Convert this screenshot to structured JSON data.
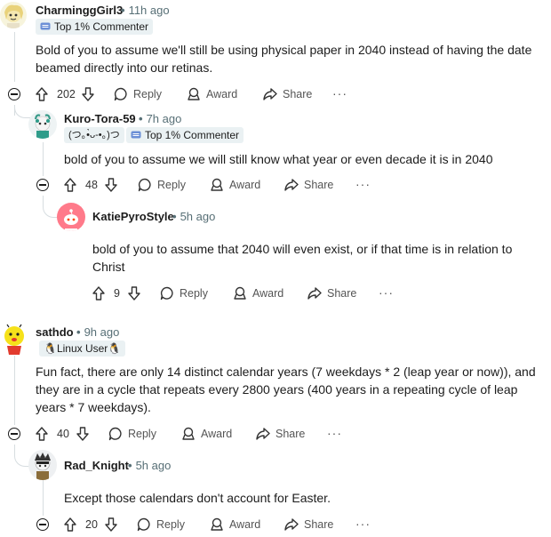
{
  "comments": [
    {
      "username": "CharminggGirl3",
      "time": "11h ago",
      "flair": "Top 1% Commenter",
      "body": "Bold of you to assume we'll still be using physical paper in 2040 instead of having the date beamed directly into our retinas.",
      "votes": "202"
    },
    {
      "username": "Kuro-Tora-59",
      "time": "7h ago",
      "flair_emoji": "(つ｡•̀ᴗ-•｡)つ",
      "flair": "Top 1% Commenter",
      "body": "bold of you to assume we will still know what year or even decade it is in 2040",
      "votes": "48"
    },
    {
      "username": "KatiePyroStyle",
      "time": "5h ago",
      "body": "bold of you to assume that 2040 will even exist, or if that time is in relation to Christ",
      "votes": "9"
    },
    {
      "username": "sathdo",
      "time": "9h ago",
      "flair": "🐧Linux User🐧",
      "body": "Fun fact, there are only 14 distinct calendar years (7 weekdays * 2 (leap year or now)), and they are in a cycle that repeats every 2800 years (400 years in a repeating cycle of leap years * 7 weekdays).",
      "votes": "40"
    },
    {
      "username": "Rad_Knight",
      "time": "5h ago",
      "body": "Except those calendars don't account for Easter.",
      "votes": "20"
    }
  ],
  "actions": {
    "reply": "Reply",
    "award": "Award",
    "share": "Share",
    "more": "···"
  },
  "time_dot": "•",
  "colors": {
    "muted": "#576f76",
    "flair_bg": "#eaf1f3",
    "thread_line": "#d7dde0"
  }
}
